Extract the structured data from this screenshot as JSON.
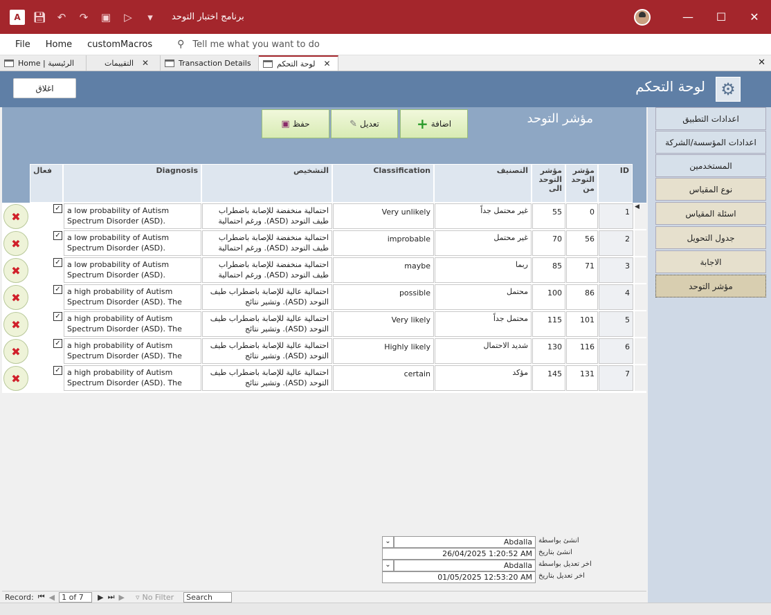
{
  "window": {
    "title": "برنامج اختبار التوحد",
    "app_badge": "A"
  },
  "menu": {
    "file": "File",
    "home": "Home",
    "custom": "customMacros",
    "tell_me": "Tell me what you want to do"
  },
  "tabs": [
    {
      "label": "Home | الرئيسية"
    },
    {
      "label": "التقييمات"
    },
    {
      "label": "Transaction Details"
    },
    {
      "label": "لوحة التحكم"
    }
  ],
  "header": {
    "close_label": "اغلاق",
    "title": "لوحة التحكم"
  },
  "nav": [
    {
      "label": "اعدادات التطبيق"
    },
    {
      "label": "اعدادات المؤسسة/الشركة"
    },
    {
      "label": "المستخدمين"
    },
    {
      "label": "نوع المقياس"
    },
    {
      "label": "اسئلة المقياس"
    },
    {
      "label": "جدول التحويل"
    },
    {
      "label": "الاجابة"
    },
    {
      "label": "مؤشر التوحد"
    }
  ],
  "section": {
    "title": "مؤشر التوحد",
    "add_label": "اضافة",
    "edit_label": "تعديل",
    "save_label": "حفظ"
  },
  "columns": {
    "id": "ID",
    "from": "مؤشر التوحد من",
    "to": "مؤشر التوحد الى",
    "category_ar": "التصنيف",
    "classification": "Classification",
    "diagnosis_ar": "التشخيص",
    "diagnosis": "Diagnosis",
    "active": "فعال"
  },
  "rows": [
    {
      "id": "1",
      "from": "0",
      "to": "55",
      "category_ar": "غير محتمل جداً",
      "classification": "Very unlikely",
      "diagnosis_ar": "احتمالية منخفضة للإصابة باضطراب طيف التوحد (ASD). ورغم احتمالية",
      "diagnosis": "a low probability of Autism Spectrum Disorder (ASD).",
      "active": true
    },
    {
      "id": "2",
      "from": "56",
      "to": "70",
      "category_ar": "غير محتمل",
      "classification": "improbable",
      "diagnosis_ar": "احتمالية منخفضة للإصابة باضطراب طيف التوحد (ASD). ورغم احتمالية",
      "diagnosis": "a low probability of Autism Spectrum Disorder (ASD).",
      "active": true
    },
    {
      "id": "3",
      "from": "71",
      "to": "85",
      "category_ar": "ربما",
      "classification": "maybe",
      "diagnosis_ar": "احتمالية منخفضة للإصابة باضطراب طيف التوحد (ASD). ورغم احتمالية",
      "diagnosis": "a low probability of Autism Spectrum Disorder (ASD).",
      "active": true
    },
    {
      "id": "4",
      "from": "86",
      "to": "100",
      "category_ar": "محتمل",
      "classification": "possible",
      "diagnosis_ar": "احتمالية عالية للإصابة باضطراب طيف التوحد (ASD). وتشير نتائج",
      "diagnosis": "a high probability of Autism Spectrum Disorder (ASD). The",
      "active": true
    },
    {
      "id": "5",
      "from": "101",
      "to": "115",
      "category_ar": "محتمل جداً",
      "classification": "Very likely",
      "diagnosis_ar": "احتمالية عالية للإصابة باضطراب طيف التوحد (ASD). وتشير نتائج",
      "diagnosis": "a high probability of Autism Spectrum Disorder (ASD). The",
      "active": true
    },
    {
      "id": "6",
      "from": "116",
      "to": "130",
      "category_ar": "شديد الاحتمال",
      "classification": "Highly likely",
      "diagnosis_ar": "احتمالية عالية للإصابة باضطراب طيف التوحد (ASD). وتشير نتائج",
      "diagnosis": "a high probability of Autism Spectrum Disorder (ASD). The",
      "active": true
    },
    {
      "id": "7",
      "from": "131",
      "to": "145",
      "category_ar": "مؤكد",
      "classification": "certain",
      "diagnosis_ar": "احتمالية عالية للإصابة باضطراب طيف التوحد (ASD). وتشير نتائج",
      "diagnosis": "a high probability of Autism Spectrum Disorder (ASD). The",
      "active": true
    }
  ],
  "audit": {
    "created_by_label": "انشئ بواسطة",
    "created_by": "Abdalla",
    "created_on_label": "انشئ بتاريخ",
    "created_on": "26/04/2025 1:20:52 AM",
    "modified_by_label": "اخر تعديل بواسطة",
    "modified_by": "Abdalla",
    "modified_on_label": "اخر تعديل بتاريخ",
    "modified_on": "01/05/2025 12:53:20 AM"
  },
  "recnav": {
    "record_label": "Record:",
    "position": "1 of 7",
    "filter": "No Filter",
    "search": "Search"
  }
}
